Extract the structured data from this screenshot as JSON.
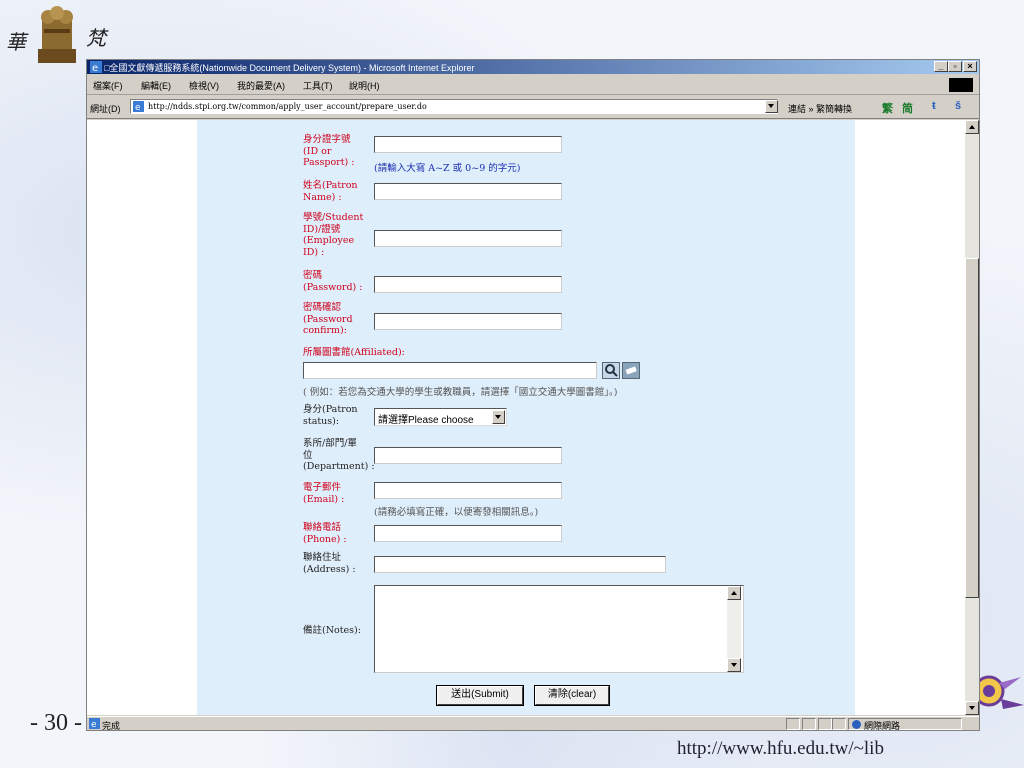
{
  "slide": {
    "logo_left_char": "華",
    "logo_right_char": "梵",
    "page_number": "- 30 -",
    "url": "http://www.hfu.edu.tw/~lib"
  },
  "window": {
    "title": "□全國文獻傳遞服務系統(Nationwide Document Delivery System) - Microsoft Internet Explorer",
    "controls": [
      "_",
      "▫",
      "×"
    ]
  },
  "menu": {
    "items": [
      "檔案(F)",
      "編輯(E)",
      "檢視(V)",
      "我的最愛(A)",
      "工具(T)",
      "說明(H)"
    ]
  },
  "address": {
    "label": "網址(D)",
    "url": "http://ndds.stpi.org.tw/common/apply_user_account/prepare_user.do",
    "links_label": "連結 » 繁簡轉換",
    "tool_icons": [
      "繁",
      "简",
      "ŧ",
      "š"
    ]
  },
  "form": {
    "id": {
      "label_lines": [
        "身分證字號",
        "(ID or",
        "Passport) :"
      ],
      "hint": "(請輸入大寫 A~Z 或 0~9 的字元)"
    },
    "name": {
      "label_lines": [
        "姓名(Patron",
        "Name) :"
      ]
    },
    "student_id": {
      "label_lines": [
        "學號/Student",
        "ID)/證號",
        "(Employee",
        "ID) :"
      ]
    },
    "password": {
      "label_lines": [
        "密碼",
        "(Password) :"
      ]
    },
    "password_confirm": {
      "label_lines": [
        "密碼確認",
        "(Password",
        "confirm):"
      ]
    },
    "affiliated": {
      "label": "所屬圖書館(Affiliated):",
      "example": "( 例如：若您為交通大學的學生或教職員，請選擇「國立交通大學圖書館」。)"
    },
    "status": {
      "label_lines": [
        "身分(Patron",
        "status):"
      ],
      "selected": "請選擇Please choose"
    },
    "department": {
      "label_lines": [
        "系所/部門/單",
        "位",
        "(Department) :"
      ]
    },
    "email": {
      "label_lines": [
        "電子郵件",
        "(Email) :"
      ],
      "hint": "(請務必填寫正確，以便寄發相關訊息。)"
    },
    "phone": {
      "label_lines": [
        "聯絡電話",
        "(Phone) :"
      ]
    },
    "address": {
      "label_lines": [
        "聯絡住址",
        "(Address) :"
      ]
    },
    "notes": {
      "label": "備註(Notes):"
    },
    "submit_label": "送出(Submit)",
    "clear_label": "清除(clear)"
  },
  "status_bar": {
    "text": "完成",
    "zone": "網際網路"
  },
  "colors": {
    "required_label": "#d0021b",
    "hint_blue": "#1a2fb0",
    "panel_bg": "#dfeefb",
    "titlebar": "#0a246a"
  }
}
